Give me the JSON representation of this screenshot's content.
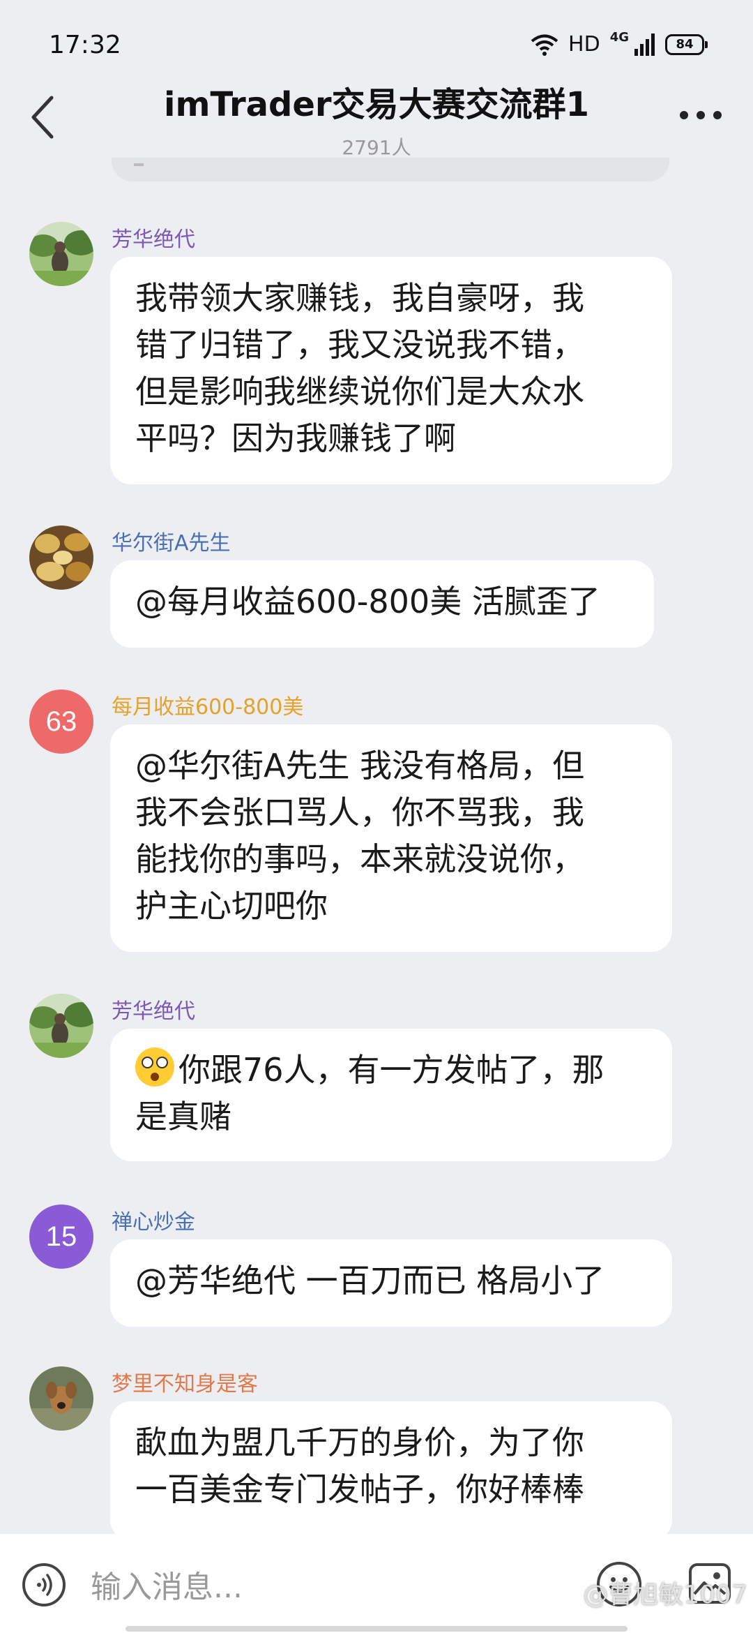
{
  "status_bar": {
    "time": "17:32",
    "hd": "HD",
    "network": "4G",
    "battery": "84"
  },
  "header": {
    "title": "imTrader交易大赛交流群1",
    "member_count": "2791人"
  },
  "messages": [
    {
      "sender": "芳华绝代",
      "sender_color": "#7b59b4",
      "avatar": "landscape-photo",
      "text": "我带领大家赚钱，我自豪呀，我\n错了归错了，我又没说我不错，\n但是影响我继续说你们是大众水\n平吗？因为我赚钱了啊"
    },
    {
      "sender": "华尔街A先生",
      "sender_color": "#4b6fb3",
      "avatar": "food-photo",
      "text": "@每月收益600-800美 活腻歪了"
    },
    {
      "sender": "每月收益600-800美",
      "sender_color": "#e5a12a",
      "avatar_text": "63",
      "avatar_color": "#ee6a6a",
      "text": "@华尔街A先生 我没有格局，但\n我不会张口骂人，你不骂我，我\n能找你的事吗，本来就没说你，\n护主心切吧你"
    },
    {
      "sender": "芳华绝代",
      "sender_color": "#7b59b4",
      "avatar": "landscape-photo",
      "text": "你跟76人，有一方发帖了，那\n是真赌"
    },
    {
      "sender": "禅心炒金",
      "sender_color": "#4b6fb3",
      "avatar_text": "15",
      "avatar_color": "#8a5bd6",
      "text": "@芳华绝代 一百刀而已 格局小了"
    },
    {
      "sender": "梦里不知身是客",
      "sender_color": "#e07a4a",
      "avatar": "dog-photo",
      "text": "歃血为盟几千万的身价，为了你\n一百美金专门发帖子，你好棒棒"
    }
  ],
  "input": {
    "placeholder": "输入消息..."
  },
  "watermark": "@曹旭敏1007"
}
